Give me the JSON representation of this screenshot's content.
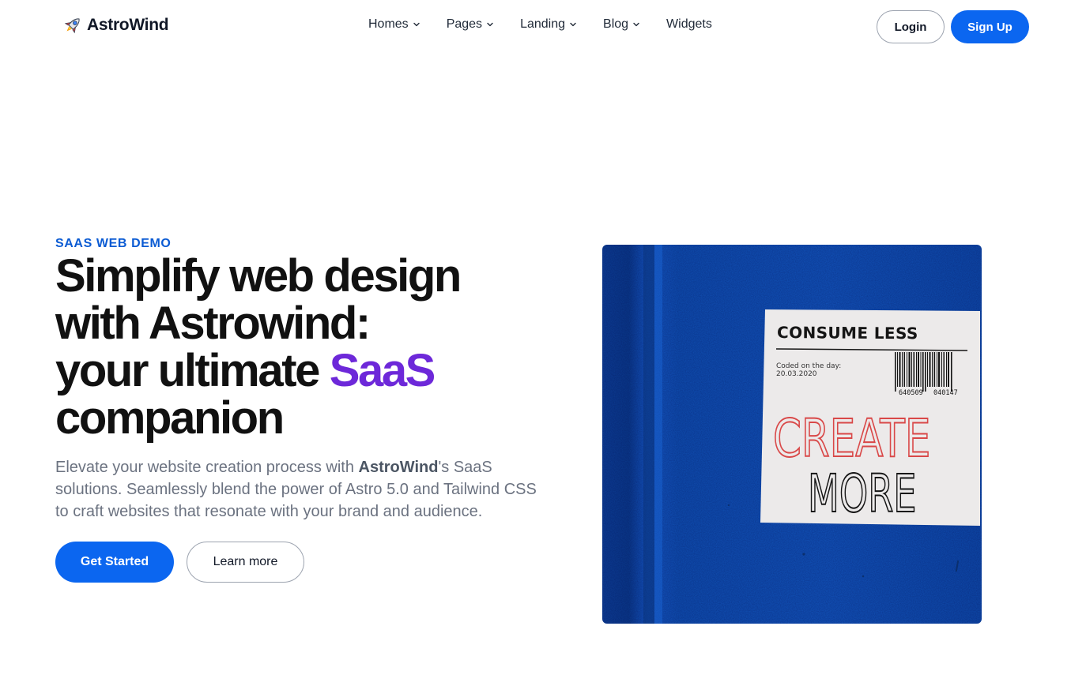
{
  "header": {
    "brand_name": "AstroWind",
    "logo_icon": "rocket-icon",
    "nav": [
      {
        "label": "Homes",
        "has_dropdown": true
      },
      {
        "label": "Pages",
        "has_dropdown": true
      },
      {
        "label": "Landing",
        "has_dropdown": true
      },
      {
        "label": "Blog",
        "has_dropdown": true
      },
      {
        "label": "Widgets",
        "has_dropdown": false
      }
    ],
    "login_label": "Login",
    "signup_label": "Sign Up"
  },
  "hero": {
    "tagline": "SAAS WEB DEMO",
    "title_line1": "Simplify web design",
    "title_line2": "with Astrowind:",
    "title_line3_pre": "your ultimate ",
    "title_highlight": "SaaS",
    "title_line4": "companion",
    "desc_pre": "Elevate your website creation process with ",
    "desc_brand": "AstroWind",
    "desc_post": "'s SaaS solutions. Seamlessly blend the power of Astro 5.0 and Tailwind CSS to craft websites that resonate with your brand and audience.",
    "primary_cta": "Get Started",
    "secondary_cta": "Learn more"
  },
  "image": {
    "sticker_heading": "CONSUME LESS",
    "coded_label": "Coded on the day:",
    "coded_date": "20.03.2020",
    "barcode_left": "640509",
    "barcode_right": "040147",
    "word_create": "CREATE",
    "word_more": "MORE"
  },
  "colors": {
    "accent_blue": "#0b66f0",
    "tagline_blue": "#0b5bd3",
    "highlight_purple": "#6d28d9",
    "image_background": "#0f4fb0",
    "create_red": "#d94848"
  }
}
